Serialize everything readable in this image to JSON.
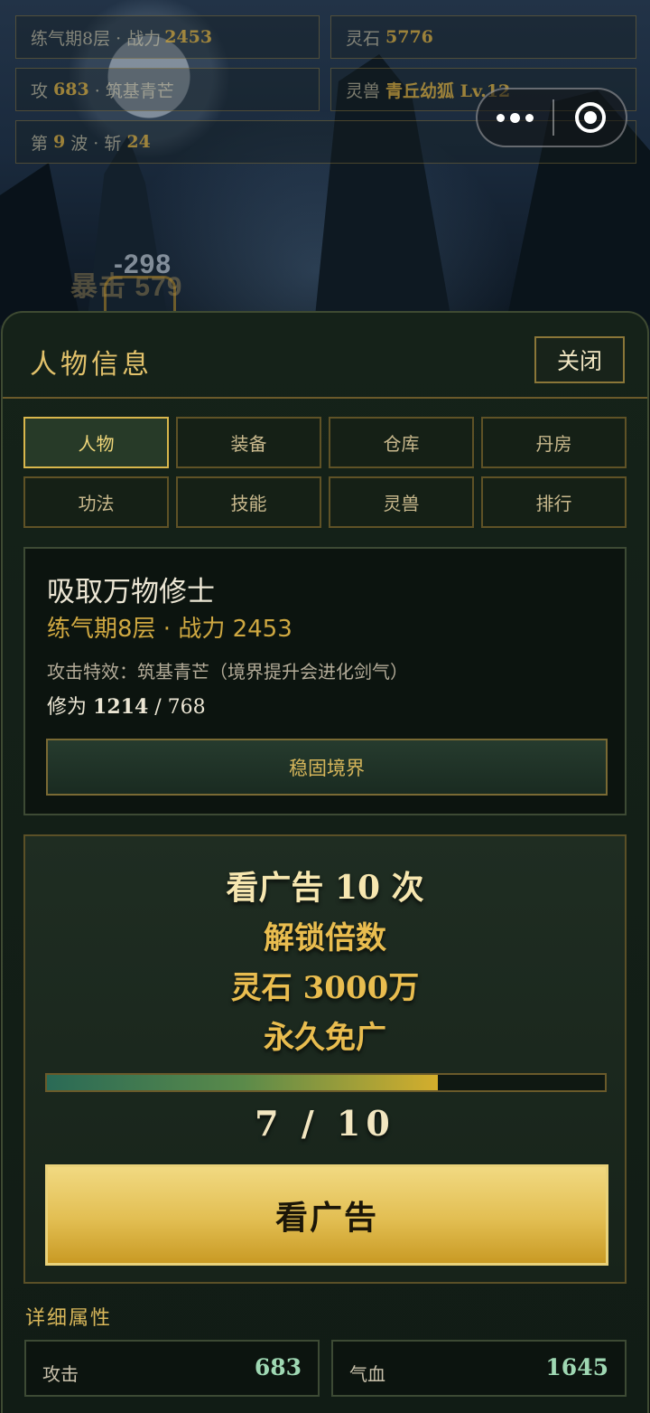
{
  "hud": {
    "realm_label": "练气期8层 · 战力",
    "realm_power": "2453",
    "stones_label": "灵石",
    "stones_value": "5776",
    "attack_label": "攻",
    "attack_value": "683",
    "attack_effect": "· 筑基青芒",
    "beast_label": "灵兽",
    "beast_name": "青丘幼狐 Lv.12",
    "wave_label": "第",
    "wave_value": "9",
    "wave_mid": "波 · 斩",
    "wave_kills": "24"
  },
  "battle": {
    "damage_text": "-298",
    "crit_text": "暴击 579"
  },
  "panel": {
    "title": "人物信息",
    "close_label": "关闭",
    "tabs": [
      {
        "label": "人物",
        "active": true
      },
      {
        "label": "装备",
        "active": false
      },
      {
        "label": "仓库",
        "active": false
      },
      {
        "label": "丹房",
        "active": false
      },
      {
        "label": "功法",
        "active": false
      },
      {
        "label": "技能",
        "active": false
      },
      {
        "label": "灵兽",
        "active": false
      },
      {
        "label": "排行",
        "active": false
      }
    ]
  },
  "character": {
    "name": "吸取万物修士",
    "realm_line": "练气期8层 · 战力 2453",
    "attack_effect": "攻击特效：筑基青芒（境界提升会进化剑气）",
    "cultivation_label": "修为",
    "cultivation_current": "1214",
    "cultivation_sep": "/",
    "cultivation_max": "768",
    "stabilize_label": "稳固境界"
  },
  "ad": {
    "line1": "看广告 10 次",
    "line2": "解锁倍数",
    "line3": "灵石 3000万",
    "line4": "永久免广",
    "progress_current": 7,
    "progress_total": 10,
    "progress_text": "7 / 10",
    "button_label": "看广告"
  },
  "attributes": {
    "section_title": "详细属性",
    "items": [
      {
        "label": "攻击",
        "value": "683"
      },
      {
        "label": "气血",
        "value": "1645"
      }
    ]
  },
  "colors": {
    "gold": "#e2c26b",
    "accent_green": "#9fd8b3",
    "button_gold": "#e2be52"
  }
}
